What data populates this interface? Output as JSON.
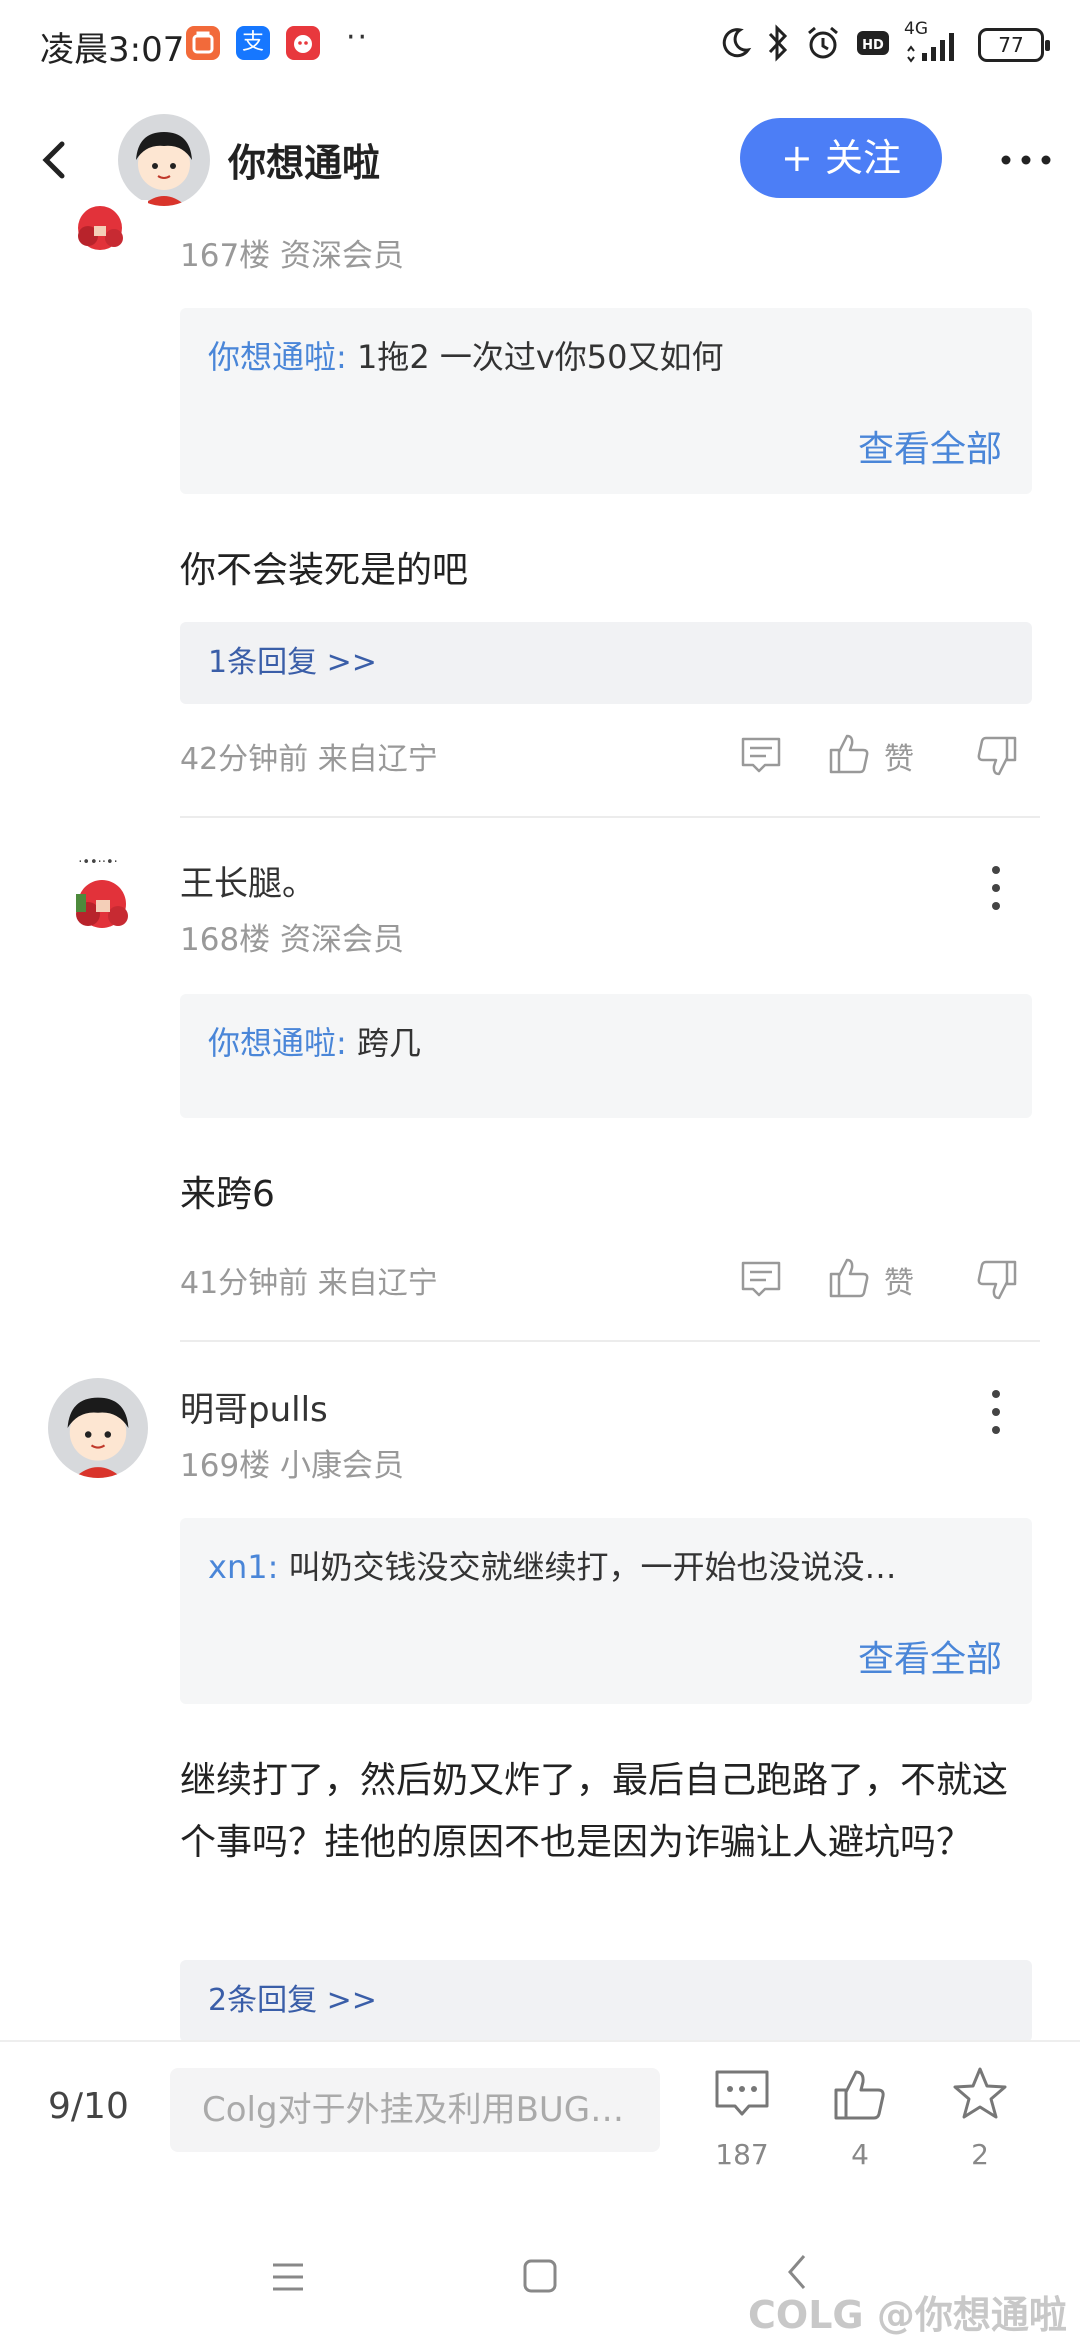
{
  "status_bar": {
    "time": "凌晨3:07",
    "app_icons": [
      {
        "name": "taobao-icon",
        "glyph": "",
        "color": "#f26a3a"
      },
      {
        "name": "alipay-icon",
        "glyph": "支",
        "color": "#1677ff"
      },
      {
        "name": "pinduoduo-icon",
        "glyph": "",
        "color": "#e8383d"
      }
    ],
    "dots": "··",
    "network": "4G",
    "battery": "77"
  },
  "header": {
    "title": "你想通啦",
    "follow_label": "+ 关注"
  },
  "comments": [
    {
      "floor": "167楼 资深会员",
      "quote_user": "你想通啦:",
      "quote_text": " 1拖2 一次过v你50又如何",
      "quote_more": "查看全部",
      "body": "你不会装死是的吧",
      "replies": "1条回复 >>",
      "time": "42分钟前 来自辽宁",
      "like_label": "赞"
    },
    {
      "name": "王长腿。",
      "floor": "168楼 资深会员",
      "quote_user": "你想通啦:",
      "quote_text": " 跨几",
      "body": "来跨6",
      "time": "41分钟前 来自辽宁",
      "like_label": "赞"
    },
    {
      "name": "明哥pulls",
      "floor": "169楼 小康会员",
      "quote_user": "xn1:",
      "quote_text": " 叫奶交钱没交就继续打，一开始也没说没…",
      "quote_more": "查看全部",
      "body": "继续打了，然后奶又炸了，最后自己跑路了，不就这个事吗？挂他的原因不也是因为诈骗让人避坑吗？",
      "replies": "2条回复 >>"
    }
  ],
  "bottom_bar": {
    "page": "9/10",
    "input_placeholder": "Colg对于外挂及利用BUG…",
    "comment_count": "187",
    "like_count": "4",
    "star_count": "2"
  },
  "watermark": "COLG @你想通啦",
  "colors": {
    "accent": "#4c7ef6",
    "link": "#4a86d8"
  }
}
